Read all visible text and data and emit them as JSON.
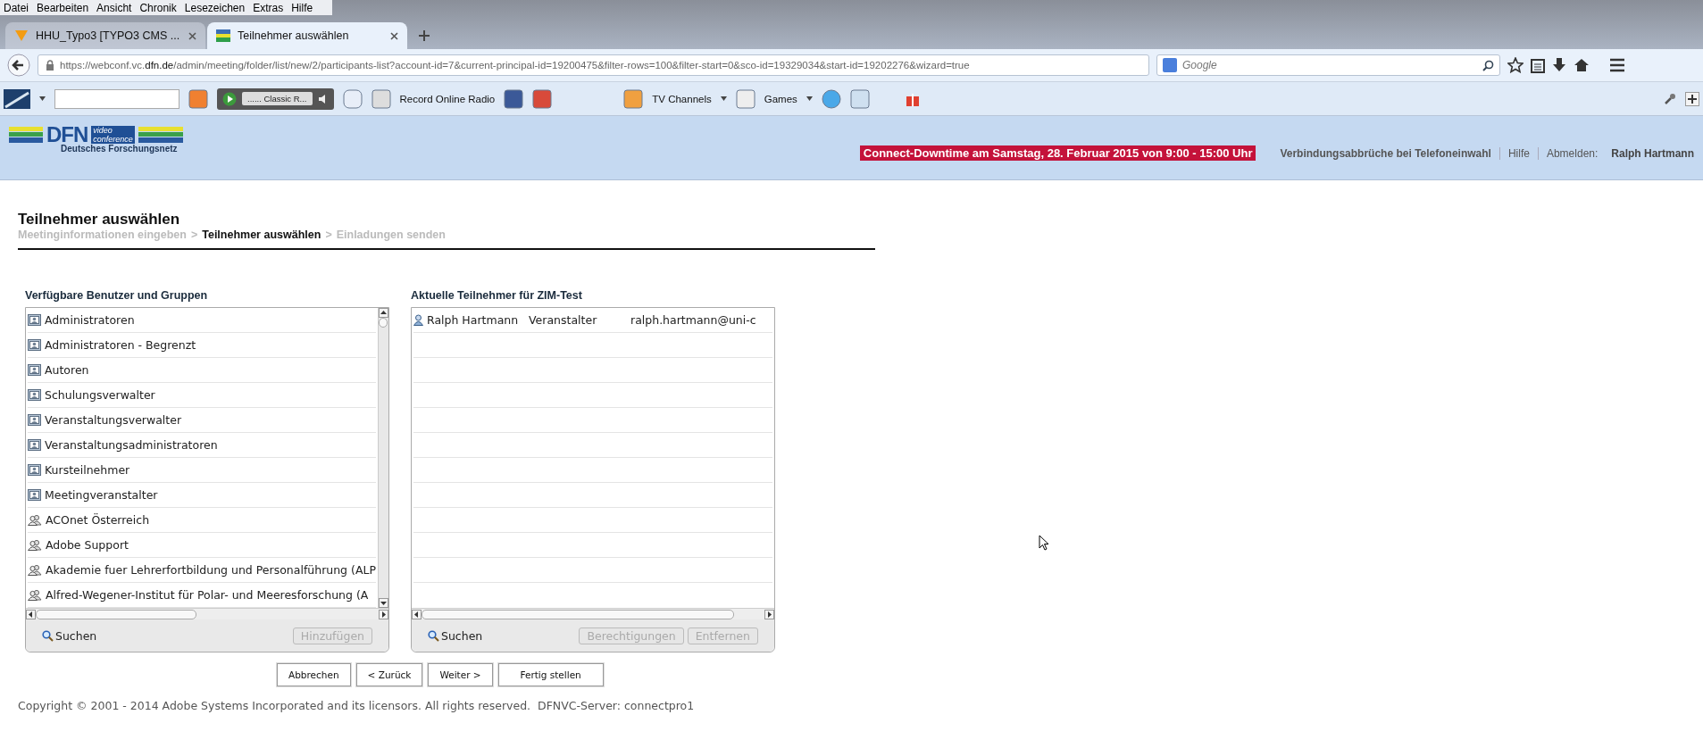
{
  "menu_bar": [
    "Datei",
    "Bearbeiten",
    "Ansicht",
    "Chronik",
    "Lesezeichen",
    "Extras",
    "Hilfe"
  ],
  "tabs": [
    {
      "label": "HHU_Typo3 [TYPO3 CMS ...",
      "selected": false
    },
    {
      "label": "Teilnehmer auswählen",
      "selected": true
    }
  ],
  "address_bar": {
    "url_prefix": "https://webconf.vc.",
    "url_domain": "dfn.de",
    "url_rest": "/admin/meeting/folder/list/new/2/participants-list?account-id=7&current-principal-id=19200475&filter-rows=100&filter-start=0&sco-id=19329034&start-id=19202276&wizard=true"
  },
  "search": {
    "placeholder": "Google"
  },
  "toolbar": {
    "radio_station": "...... Classic R...",
    "record_label": "Record Online Radio",
    "tv_label": "TV Channels",
    "games_label": "Games"
  },
  "header": {
    "logo_text": "DFN",
    "logo_sub1": "video",
    "logo_sub2": "conference",
    "logo_caption": "Deutsches Forschungsnetz",
    "notice": "Connect-Downtime am Samstag, 28. Februar 2015 von 9:00 - 15:00 Uhr",
    "links": [
      "Verbindungsabbrüche bei Telefoneinwahl",
      "Hilfe"
    ],
    "logout_label": "Abmelden:",
    "user": "Ralph Hartmann"
  },
  "page": {
    "title": "Teilnehmer auswählen",
    "steps": [
      {
        "label": "Meetinginformationen eingeben",
        "selected": false
      },
      {
        "label": "Teilnehmer auswählen",
        "selected": true
      },
      {
        "label": "Einladungen senden",
        "selected": false
      }
    ],
    "separator": ">"
  },
  "available": {
    "heading": "Verfügbare Benutzer und Gruppen",
    "items": [
      {
        "kind": "group",
        "label": "Administratoren"
      },
      {
        "kind": "group",
        "label": "Administratoren - Begrenzt"
      },
      {
        "kind": "group",
        "label": "Autoren"
      },
      {
        "kind": "group",
        "label": "Schulungsverwalter"
      },
      {
        "kind": "group",
        "label": "Veranstaltungsverwalter"
      },
      {
        "kind": "group",
        "label": "Veranstaltungsadministratoren"
      },
      {
        "kind": "group",
        "label": "Kursteilnehmer"
      },
      {
        "kind": "group",
        "label": "Meetingveranstalter"
      },
      {
        "kind": "users",
        "label": "ACOnet Österreich"
      },
      {
        "kind": "users",
        "label": "Adobe Support"
      },
      {
        "kind": "users",
        "label": "Akademie fuer Lehrerfortbildung und Personalführung (ALP"
      },
      {
        "kind": "users",
        "label": "Alfred-Wegener-Institut für Polar- und Meeresforschung (A"
      }
    ],
    "search_label": "Suchen",
    "buttons": [
      {
        "label": "Hinzufügen",
        "disabled": true
      }
    ]
  },
  "participants": {
    "heading": "Aktuelle Teilnehmer für ZIM-Test",
    "rows": [
      {
        "name": "Ralph Hartmann",
        "role": "Veranstalter",
        "email": "ralph.hartmann@uni-c"
      }
    ],
    "search_label": "Suchen",
    "buttons": [
      {
        "label": "Berechtigungen",
        "disabled": true
      },
      {
        "label": "Entfernen",
        "disabled": true
      }
    ]
  },
  "wizard_buttons": [
    "Abbrechen",
    "< Zurück",
    "Weiter >",
    "Fertig stellen"
  ],
  "footer": "Copyright © 2001 - 2014 Adobe Systems Incorporated and its licensors. All rights reserved.  DFNVC-Server: connectpro1"
}
